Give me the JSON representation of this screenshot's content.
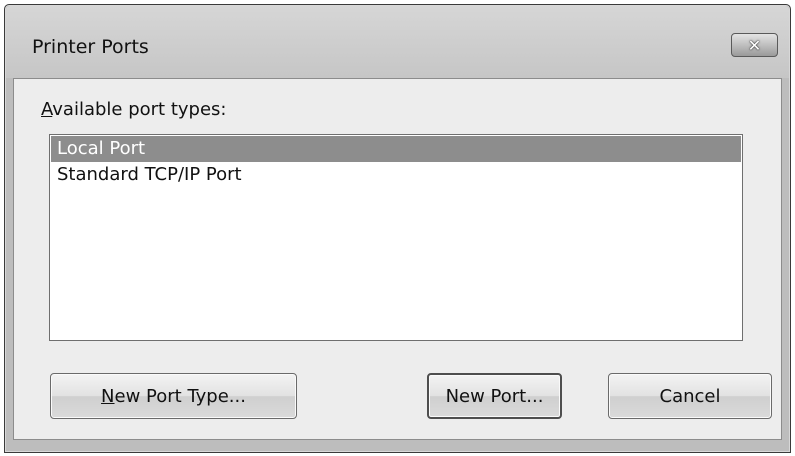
{
  "dialog": {
    "title": "Printer Ports",
    "close_symbol": "✕"
  },
  "label": {
    "mnemonic": "A",
    "rest": "vailable port types:"
  },
  "port_types": [
    {
      "label": "Local Port",
      "selected": true
    },
    {
      "label": "Standard TCP/IP Port",
      "selected": false
    }
  ],
  "buttons": {
    "new_port_type": {
      "mnemonic": "N",
      "rest": "ew Port Type..."
    },
    "new_port": "New Port...",
    "cancel": "Cancel"
  },
  "colors": {
    "selection": "#8d8d8d",
    "dialog_background": "#ededed"
  },
  "icons": {
    "close": "close-icon"
  }
}
